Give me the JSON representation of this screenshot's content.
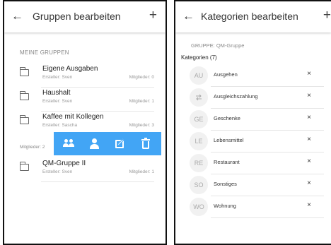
{
  "left": {
    "header": {
      "title": "Gruppen bearbeiten",
      "back_icon": "arrow-left-icon",
      "add_icon": "plus-icon"
    },
    "section_label": "MEINE GRUPPEN",
    "groups": [
      {
        "name": "Eigene Ausgaben",
        "creator": "Ersteller: Sven",
        "members": "Mitglieder: 0"
      },
      {
        "name": "Haushalt",
        "creator": "Ersteller: Sven",
        "members": "Mitglieder: 1"
      },
      {
        "name": "Kaffee mit Kollegen",
        "creator": "Ersteller: Sascha",
        "members": "Mitglieder: 3"
      }
    ],
    "swiped_row": {
      "members": "Mitglieder: 2",
      "actions": [
        "group-icon",
        "person-icon",
        "edit-icon",
        "trash-icon"
      ],
      "action_color": "#42a5f5"
    },
    "after_groups": [
      {
        "name": "QM-Gruppe II",
        "creator": "Ersteller: Sven",
        "members": "Mitglieder: 1"
      }
    ]
  },
  "right": {
    "header": {
      "title": "Kategorien bearbeiten",
      "back_icon": "arrow-left-icon",
      "add_icon": "plus-icon"
    },
    "group_label": "GRUPPE: QM-Gruppe",
    "categories_label": "Kategorien (7)",
    "categories": [
      {
        "badge": "AU",
        "name": "Ausgehen"
      },
      {
        "badge": "",
        "badge_icon": "swap-arrows-icon",
        "name": "Ausgleichszahlung"
      },
      {
        "badge": "GE",
        "name": "Geschenke"
      },
      {
        "badge": "LE",
        "name": "Lebensmittel"
      },
      {
        "badge": "RE",
        "name": "Restaurant"
      },
      {
        "badge": "SO",
        "name": "Sonstiges"
      },
      {
        "badge": "WO",
        "name": "Wohnung"
      }
    ],
    "remove_symbol": "×"
  }
}
